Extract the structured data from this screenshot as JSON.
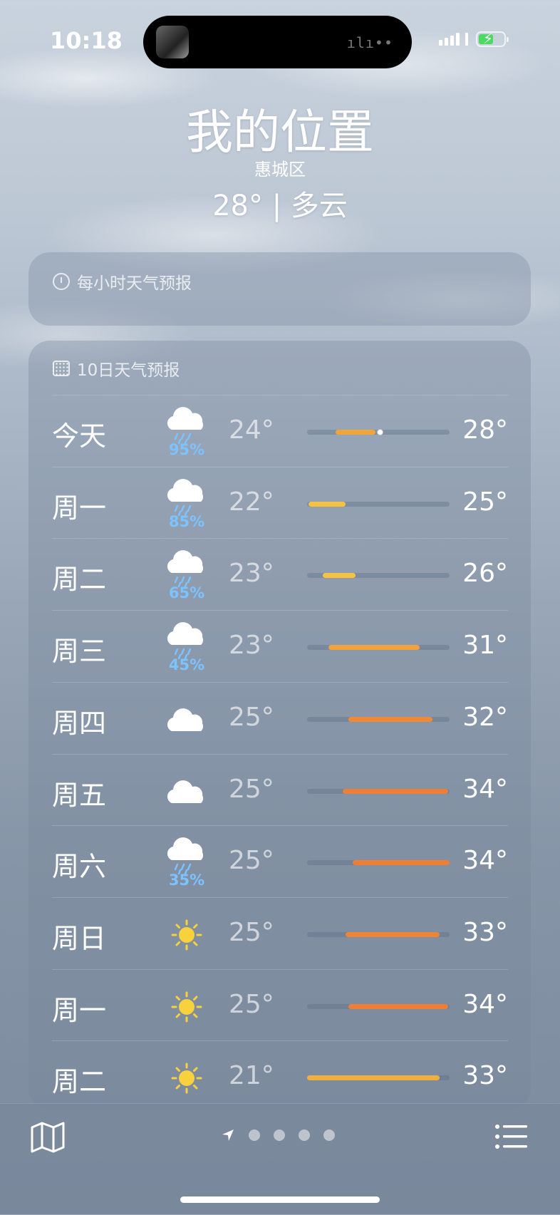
{
  "status": {
    "time": "10:18"
  },
  "header": {
    "location": "我的位置",
    "sublocation": "惠城区",
    "current": "28° | 多云"
  },
  "hourly": {
    "title": "每小时天气预报"
  },
  "daily": {
    "title": "10日天气预报",
    "days": [
      {
        "day": "今天",
        "icon": "cloud-rain-icon",
        "precip": "95%",
        "low": "24°",
        "high": "28°",
        "range": [
          0.2,
          0.48
        ],
        "current": 0.51,
        "color": "#f0a53a"
      },
      {
        "day": "周一",
        "icon": "cloud-rain-icon",
        "precip": "85%",
        "low": "22°",
        "high": "25°",
        "range": [
          0.01,
          0.27
        ],
        "color": "#f5c242"
      },
      {
        "day": "周二",
        "icon": "cloud-rain-icon",
        "precip": "65%",
        "low": "23°",
        "high": "26°",
        "range": [
          0.11,
          0.34
        ],
        "color": "#f5c242"
      },
      {
        "day": "周三",
        "icon": "cloud-rain-icon",
        "precip": "45%",
        "low": "23°",
        "high": "31°",
        "range": [
          0.15,
          0.79
        ],
        "color": "#f2a23c"
      },
      {
        "day": "周四",
        "icon": "cloud-icon",
        "precip": "",
        "low": "25°",
        "high": "32°",
        "range": [
          0.29,
          0.88
        ],
        "color": "#ee8a35"
      },
      {
        "day": "周五",
        "icon": "cloud-icon",
        "precip": "",
        "low": "25°",
        "high": "34°",
        "range": [
          0.25,
          0.99
        ],
        "color": "#ee7e35"
      },
      {
        "day": "周六",
        "icon": "cloud-rain-icon",
        "precip": "35%",
        "low": "25°",
        "high": "34°",
        "range": [
          0.32,
          1.0
        ],
        "color": "#ee7e35"
      },
      {
        "day": "周日",
        "icon": "sun-icon",
        "precip": "",
        "low": "25°",
        "high": "33°",
        "range": [
          0.27,
          0.93
        ],
        "color": "#ee8535"
      },
      {
        "day": "周一",
        "icon": "sun-icon",
        "precip": "",
        "low": "25°",
        "high": "34°",
        "range": [
          0.29,
          0.99
        ],
        "color": "#ee7e35"
      },
      {
        "day": "周二",
        "icon": "sun-icon",
        "precip": "",
        "low": "21°",
        "high": "33°",
        "range": [
          0.0,
          0.93
        ],
        "color": "#f0b040"
      }
    ]
  },
  "bottom": {
    "pages": 4,
    "left_icon": "map-icon",
    "right_icon": "list-icon",
    "location_icon": "location-arrow-icon"
  }
}
